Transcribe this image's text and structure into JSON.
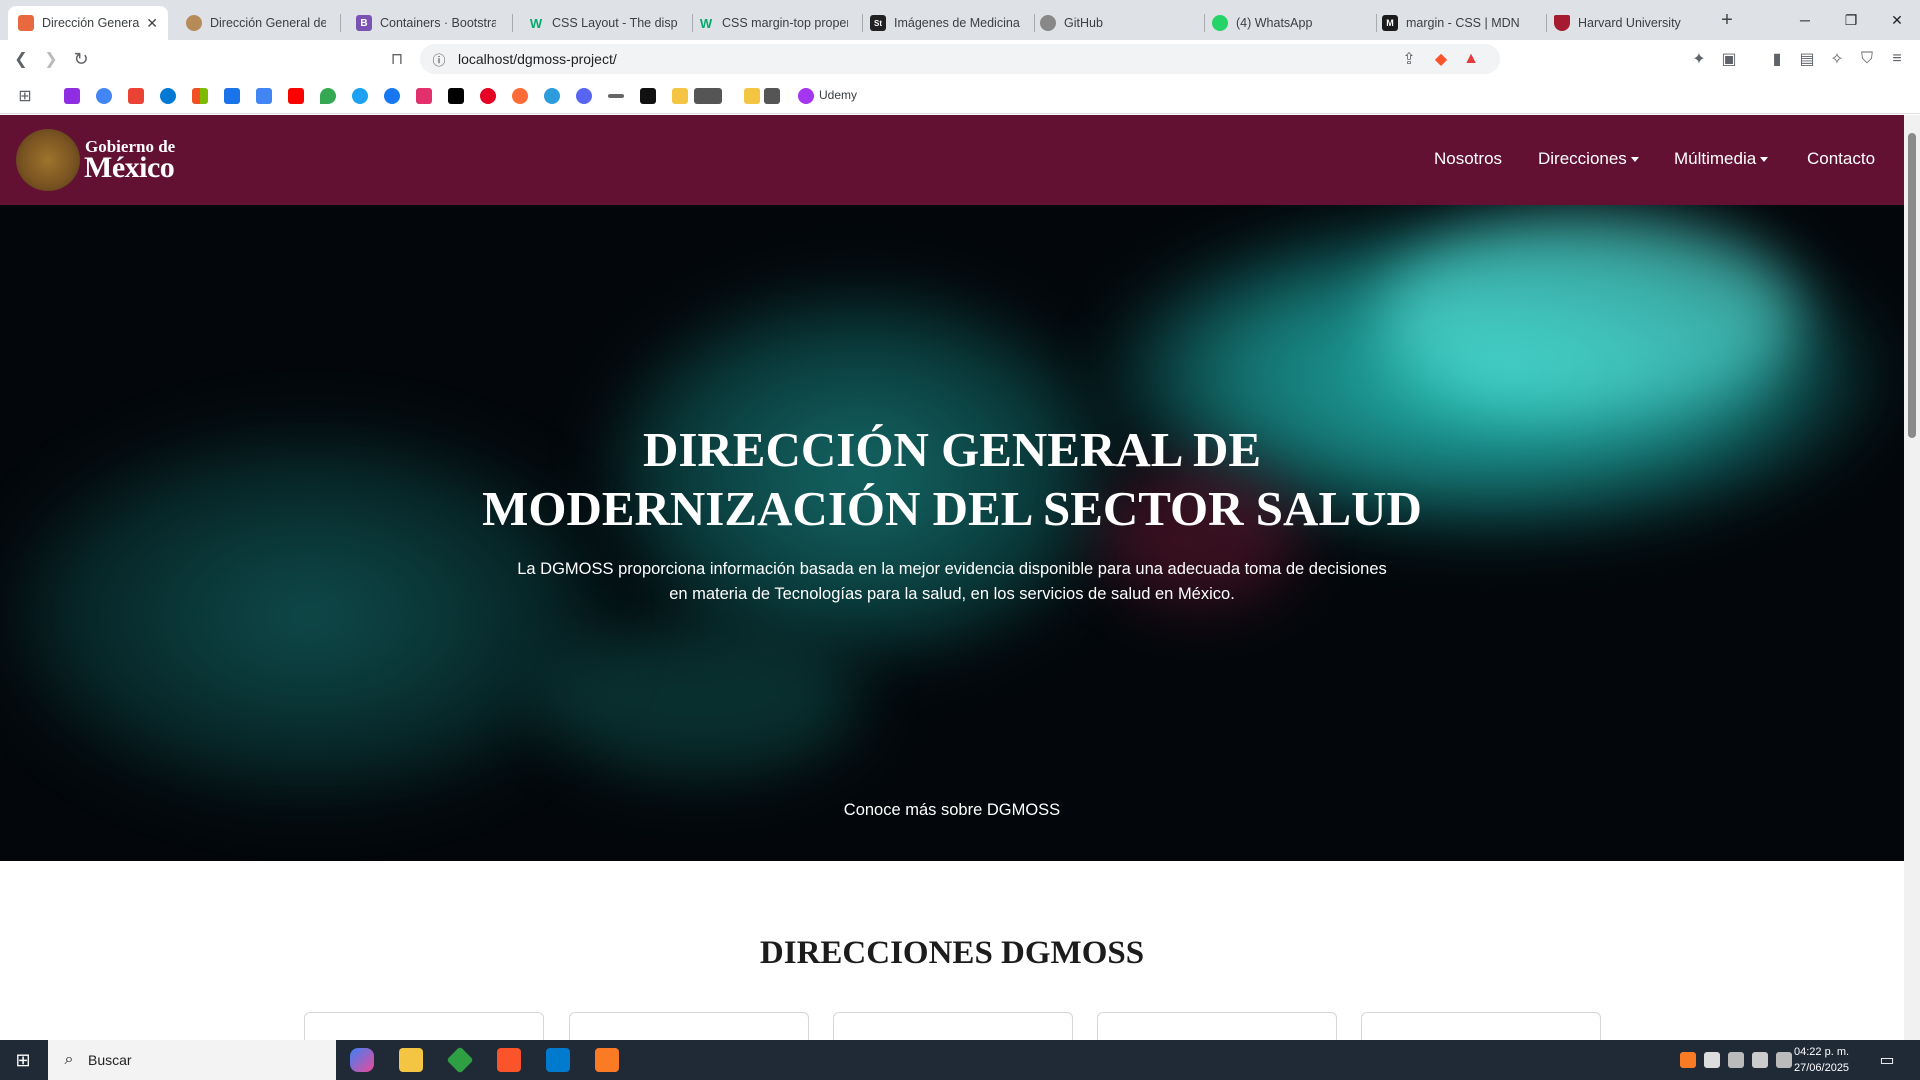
{
  "browser": {
    "tabs": [
      {
        "title": "Dirección General",
        "favicon_color": "#e8683f",
        "active": true
      },
      {
        "title": "Dirección General de M",
        "favicon_color": "#b58b5a"
      },
      {
        "title": "Containers · Bootstrap",
        "favicon_color": "#7952b3"
      },
      {
        "title": "CSS Layout - The displ",
        "favicon_color": "#04aa6d"
      },
      {
        "title": "CSS margin-top proper",
        "favicon_color": "#04aa6d"
      },
      {
        "title": "Imágenes de Medicina",
        "favicon_color": "#222222"
      },
      {
        "title": "GitHub",
        "favicon_color": "#888888"
      },
      {
        "title": "(4) WhatsApp",
        "favicon_color": "#25d366"
      },
      {
        "title": "margin - CSS | MDN",
        "favicon_color": "#1b1b1b"
      },
      {
        "title": "Harvard University",
        "favicon_color": "#a51c30"
      }
    ],
    "new_tab_label": "+",
    "url": "localhost/dgmoss-project/",
    "bookmark_udemy": "Udemy"
  },
  "site": {
    "logo_line1": "Gobierno de",
    "logo_line2": "México",
    "nav": {
      "nosotros": "Nosotros",
      "direcciones": "Direcciones",
      "multimedia": "Múltimedia",
      "contacto": "Contacto"
    },
    "hero": {
      "title_line1": "DIRECCIÓN GENERAL DE",
      "title_line2": "MODERNIZACIÓN DEL SECTOR SALUD",
      "description_line1": "La DGMOSS proporciona información basada en la mejor evidencia disponible para una adecuada toma de decisiones",
      "description_line2": "en materia de Tecnologías para la salud, en los servicios de salud en México.",
      "link": "Conoce más sobre DGMOSS"
    },
    "directions_title": "DIRECCIONES DGMOSS"
  },
  "taskbar": {
    "search_label": "Buscar",
    "time": "04:22 p. m.",
    "date": "27/06/2025"
  },
  "colors": {
    "header": "#621132",
    "accent_teal": "#33d1c8"
  }
}
